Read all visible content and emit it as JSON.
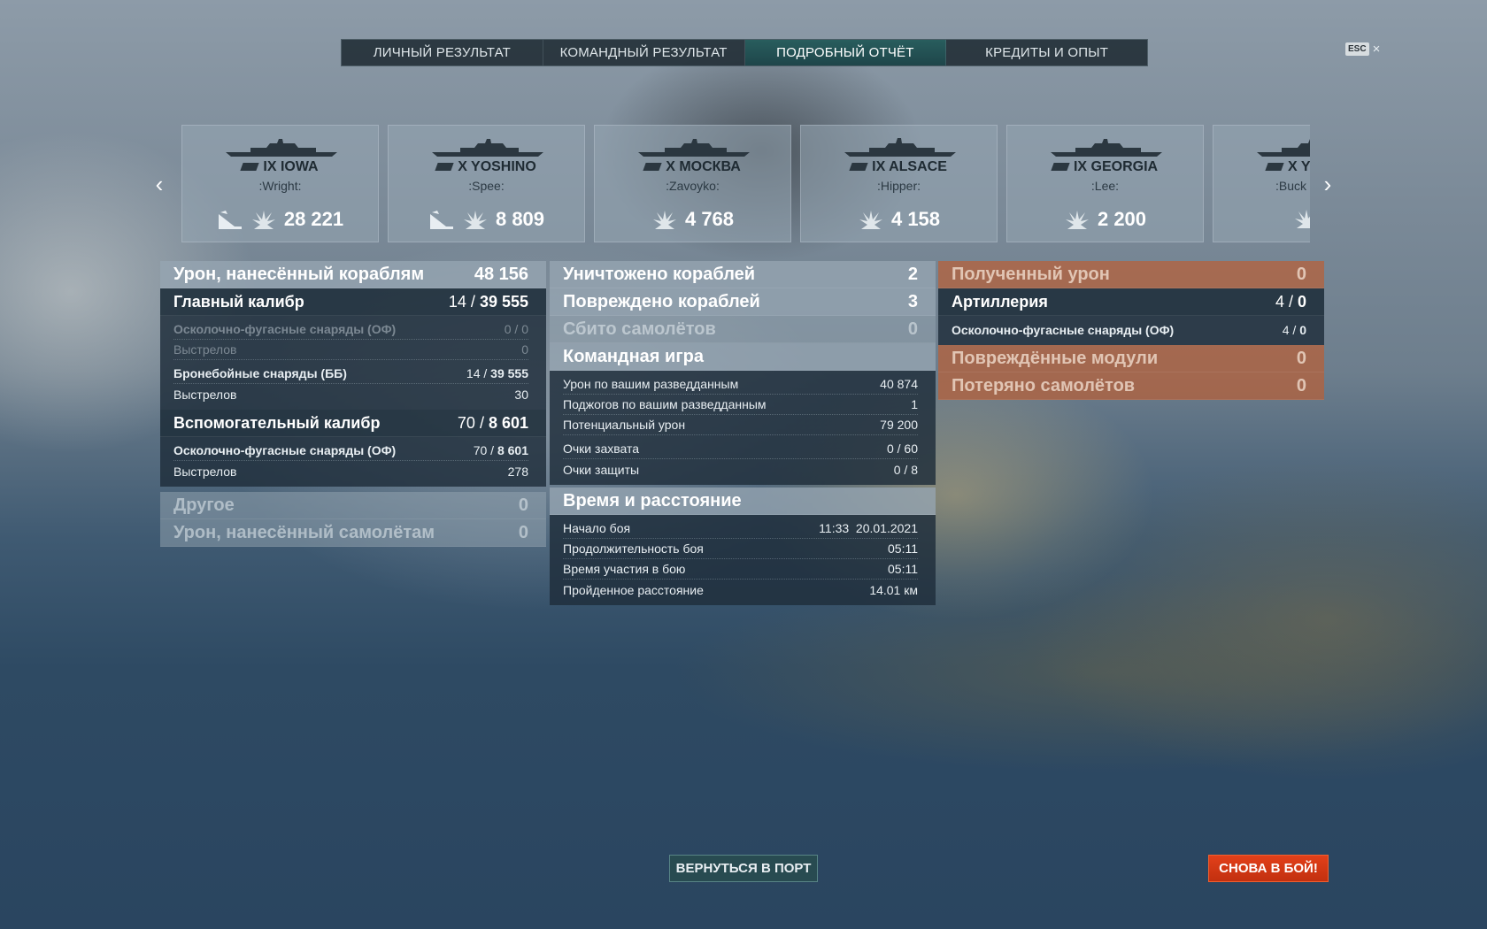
{
  "tabs": [
    {
      "label": "ЛИЧНЫЙ РЕЗУЛЬТАТ",
      "active": false
    },
    {
      "label": "КОМАНДНЫЙ РЕЗУЛЬТАТ",
      "active": false
    },
    {
      "label": "ПОДРОБНЫЙ ОТЧЁТ",
      "active": true
    },
    {
      "label": "КРЕДИТЫ И ОПЫТ",
      "active": false
    }
  ],
  "esc_label": "ESC",
  "close_glyph": "×",
  "ships": [
    {
      "name": "IX IOWA",
      "player": ":Wright:",
      "damage": "28 221",
      "sunk": true
    },
    {
      "name": "X YOSHINO",
      "player": ":Spee:",
      "damage": "8 809",
      "sunk": true
    },
    {
      "name": "X МОСКВА",
      "player": ":Zavoyko:",
      "damage": "4 768",
      "sunk": false
    },
    {
      "name": "IX ALSACE",
      "player": ":Hipper:",
      "damage": "4 158",
      "sunk": false
    },
    {
      "name": "IX GEORGIA",
      "player": ":Lee:",
      "damage": "2 200",
      "sunk": false
    },
    {
      "name": "X Y",
      "player": ":Buck",
      "damage": "",
      "sunk": false
    }
  ],
  "col1": {
    "damage_ships": {
      "label": "Урон, нанесённый кораблям",
      "value": "48 156"
    },
    "main_battery": {
      "label": "Главный калибр",
      "hits": "14",
      "value": "39 555"
    },
    "main_rows": [
      {
        "label": "Осколочно-фугасные снаряды (ОФ)",
        "value": "0 / 0"
      },
      {
        "label": "Выстрелов",
        "value": "0"
      },
      {
        "label": "Бронебойные снаряды (ББ)",
        "hits": "14",
        "bold_value": "39 555"
      },
      {
        "label": "Выстрелов",
        "value": "30"
      }
    ],
    "secondary": {
      "label": "Вспомогательный калибр",
      "hits": "70",
      "value": "8 601"
    },
    "secondary_rows": [
      {
        "label": "Осколочно-фугасные снаряды (ОФ)",
        "hits": "70",
        "bold_value": "8 601"
      },
      {
        "label": "Выстрелов",
        "value": "278"
      }
    ],
    "other": {
      "label": "Другое",
      "value": "0"
    },
    "damage_planes": {
      "label": "Урон, нанесённый самолётам",
      "value": "0"
    }
  },
  "col2": {
    "destroyed": {
      "label": "Уничтожено кораблей",
      "value": "2"
    },
    "damaged": {
      "label": "Повреждено кораблей",
      "value": "3"
    },
    "planes_shot": {
      "label": "Сбито самолётов",
      "value": "0"
    },
    "team_play": {
      "label": "Командная игра"
    },
    "team_rows": [
      {
        "label": "Урон по вашим разведданным",
        "value": "40 874"
      },
      {
        "label": "Поджогов по вашим разведданным",
        "value": "1"
      },
      {
        "label": "Потенциальный урон",
        "value": "79 200"
      },
      {
        "label": "Очки захвата",
        "value": "0 / 60"
      },
      {
        "label": "Очки защиты",
        "value": "0 / 8"
      }
    ],
    "time_distance": {
      "label": "Время и расстояние"
    },
    "time_rows": [
      {
        "label": "Начало боя",
        "value": "11:33  20.01.2021"
      },
      {
        "label": "Продолжительность боя",
        "value": "05:11"
      },
      {
        "label": "Время участия в бою",
        "value": "05:11"
      },
      {
        "label": "Пройденное расстояние",
        "value": "14.01 км"
      }
    ]
  },
  "col3": {
    "received": {
      "label": "Полученный урон",
      "value": "0"
    },
    "artillery": {
      "label": "Артиллерия",
      "hits": "4",
      "value": "0"
    },
    "art_rows": [
      {
        "label": "Осколочно-фугасные снаряды (ОФ)",
        "hits": "4",
        "bold_value": "0"
      }
    ],
    "modules": {
      "label": "Повреждённые модули",
      "value": "0"
    },
    "planes_lost": {
      "label": "Потеряно самолётов",
      "value": "0"
    }
  },
  "buttons": {
    "port": "ВЕРНУТЬСЯ В ПОРТ",
    "battle": "СНОВА В БОЙ!"
  },
  "colors": {
    "active_tab": "#285f5f",
    "battle_button": "#d8381a",
    "orange_row": "#b95f37"
  }
}
